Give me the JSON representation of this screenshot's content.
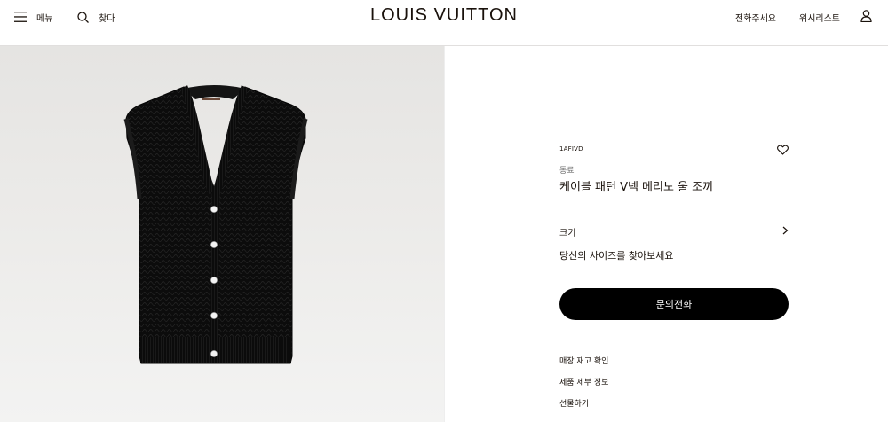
{
  "header": {
    "menu_label": "메뉴",
    "search_label": "찾다",
    "logo": "LOUIS VUITTON",
    "call_label": "전화주세요",
    "wishlist_label": "위시리스트"
  },
  "product": {
    "sku": "1AFIVD",
    "tag": "동료",
    "name": "케이블 패턴 V넥 메리노 울 조끼",
    "size_label": "크기",
    "size_finder": "당신의 사이즈를 찾아보세요",
    "call_button": "문의전화",
    "links": [
      "매장 재고 확인",
      "제품 세부 정보",
      "선물하기"
    ]
  },
  "colors": {
    "ink": "#19110b",
    "button_bg": "#000000",
    "button_text": "#ffffff",
    "image_bg": "#ebeae8"
  },
  "icons": [
    "menu-icon",
    "search-icon",
    "account-icon",
    "heart-icon",
    "chevron-right-icon"
  ]
}
